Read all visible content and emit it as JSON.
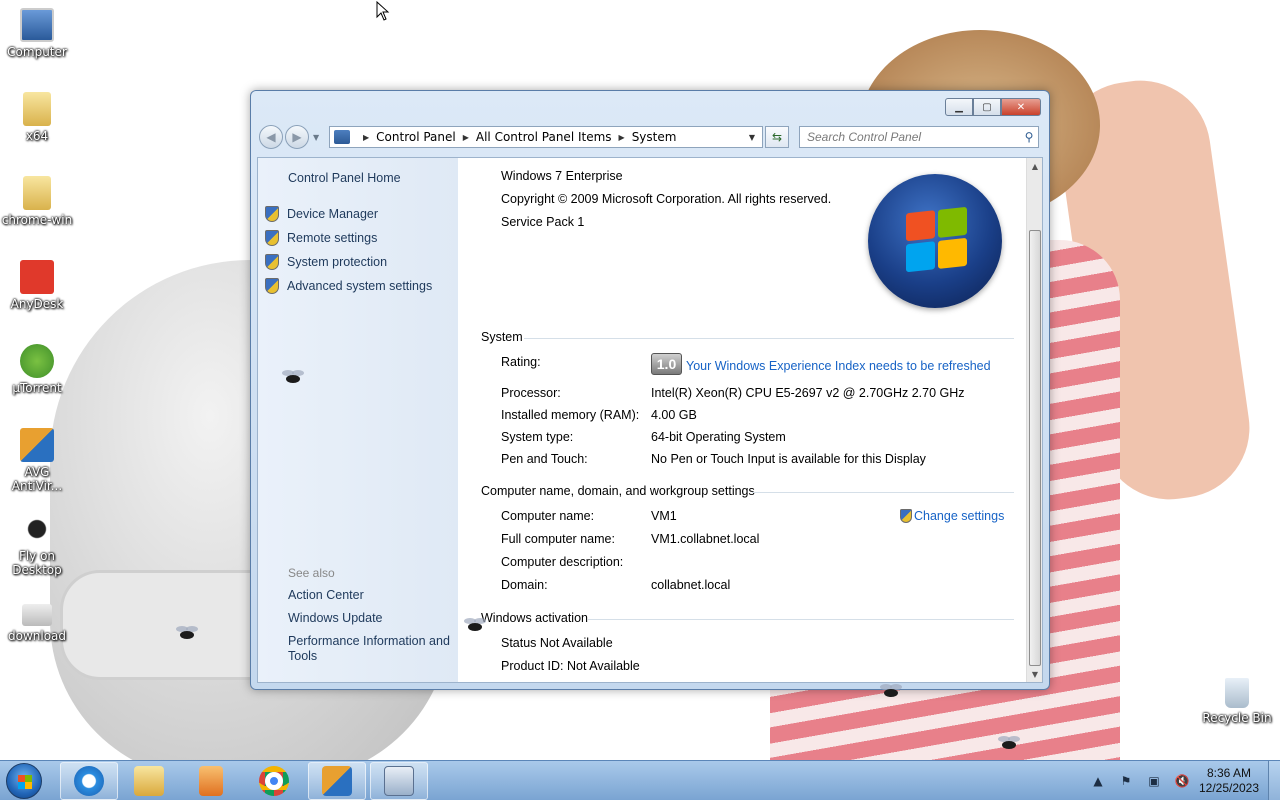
{
  "desktop": {
    "icons": [
      {
        "label": "Computer"
      },
      {
        "label": "x64"
      },
      {
        "label": "chrome-win"
      },
      {
        "label": "AnyDesk"
      },
      {
        "label": "µTorrent"
      },
      {
        "label": "AVG AntiVir..."
      },
      {
        "label": "Fly on Desktop"
      },
      {
        "label": "download"
      },
      {
        "label": "Recycle Bin"
      }
    ]
  },
  "window": {
    "address": {
      "crumbs": [
        "Control Panel",
        "All Control Panel Items",
        "System"
      ]
    },
    "search": {
      "placeholder": "Search Control Panel"
    },
    "sidebar": {
      "home": "Control Panel Home",
      "links": [
        "Device Manager",
        "Remote settings",
        "System protection",
        "Advanced system settings"
      ],
      "see_also_label": "See also",
      "see_also": [
        "Action Center",
        "Windows Update",
        "Performance Information and Tools"
      ]
    },
    "edition": {
      "name": "Windows 7 Enterprise",
      "copyright": "Copyright © 2009 Microsoft Corporation.  All rights reserved.",
      "service_pack": "Service Pack 1"
    },
    "system": {
      "title": "System",
      "rating_label": "Rating:",
      "rating_value": "1.0",
      "rating_link": "Your Windows Experience Index needs to be refreshed",
      "processor_label": "Processor:",
      "processor_value": "Intel(R) Xeon(R) CPU E5-2697 v2 @ 2.70GHz   2.70 GHz",
      "memory_label": "Installed memory (RAM):",
      "memory_value": "4.00 GB",
      "type_label": "System type:",
      "type_value": "64-bit Operating System",
      "pen_label": "Pen and Touch:",
      "pen_value": "No Pen or Touch Input is available for this Display"
    },
    "computer": {
      "title": "Computer name, domain, and workgroup settings",
      "name_label": "Computer name:",
      "name_value": "VM1",
      "change_settings": "Change settings",
      "full_label": "Full computer name:",
      "full_value": "VM1.collabnet.local",
      "desc_label": "Computer description:",
      "domain_label": "Domain:",
      "domain_value": "collabnet.local"
    },
    "activation": {
      "title": "Windows activation",
      "status": "Status Not Available",
      "product_id": "Product ID:  Not Available"
    }
  },
  "taskbar": {
    "clock_time": "8:36 AM",
    "clock_date": "12/25/2023"
  },
  "colors": {
    "link": "#1763c6",
    "sidebar_link": "#1e395b",
    "taskbar": "#7aa4d2"
  }
}
